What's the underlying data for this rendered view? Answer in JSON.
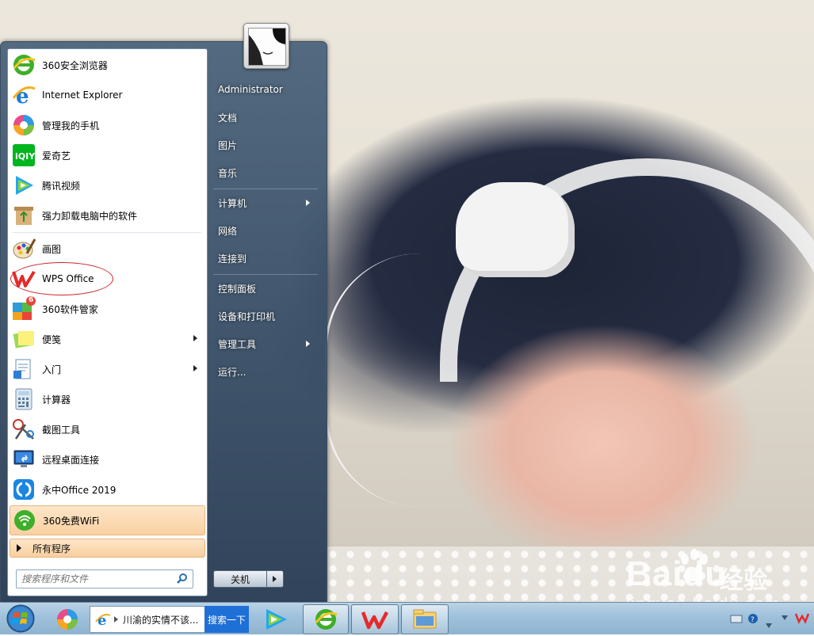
{
  "start_menu": {
    "pinned": [
      {
        "label": "360安全浏览器",
        "icon": "360-browser-icon"
      },
      {
        "label": "Internet Explorer",
        "icon": "ie-icon"
      },
      {
        "label": "管理我的手机",
        "icon": "phone-manager-icon"
      },
      {
        "label": "爱奇艺",
        "icon": "iqiyi-icon"
      },
      {
        "label": "腾讯视频",
        "icon": "tencent-video-icon"
      },
      {
        "label": "强力卸载电脑中的软件",
        "icon": "uninstall-icon"
      }
    ],
    "recent": [
      {
        "label": "画图",
        "icon": "paint-icon"
      },
      {
        "label": "WPS Office",
        "icon": "wps-icon"
      },
      {
        "label": "360软件管家",
        "icon": "360-software-manager-icon",
        "badge": "6"
      },
      {
        "label": "便笺",
        "icon": "sticky-notes-icon",
        "submenu": true
      },
      {
        "label": "入门",
        "icon": "getting-started-icon",
        "submenu": true
      },
      {
        "label": "计算器",
        "icon": "calculator-icon"
      },
      {
        "label": "截图工具",
        "icon": "snipping-tool-icon"
      },
      {
        "label": "远程桌面连接",
        "icon": "remote-desktop-icon"
      },
      {
        "label": "永中Office 2019",
        "icon": "yozo-office-icon"
      },
      {
        "label": "360免费WiFi",
        "icon": "360-wifi-icon"
      }
    ],
    "all_programs": "所有程序",
    "search_placeholder": "搜索程序和文件",
    "right_items": [
      {
        "label": "Administrator"
      },
      {
        "label": "文档"
      },
      {
        "label": "图片"
      },
      {
        "label": "音乐"
      },
      {
        "label": "计算机",
        "submenu": true
      },
      {
        "label": "网络"
      },
      {
        "label": "连接到"
      },
      {
        "label": "控制面板"
      },
      {
        "label": "设备和打印机"
      },
      {
        "label": "管理工具",
        "submenu": true
      },
      {
        "label": "运行..."
      }
    ],
    "shutdown_label": "关机"
  },
  "taskbar": {
    "ie_window_title": "川渝的实情不该...",
    "search_button": "搜索一下"
  },
  "watermark": {
    "brand": "Baidu",
    "brand_cn": "经验",
    "url": "jingyan.baidu.com"
  },
  "colors": {
    "accent_blue": "#1e6fd6",
    "highlight_orange": "#f9d0a2",
    "annotation_red": "#c9262c"
  }
}
